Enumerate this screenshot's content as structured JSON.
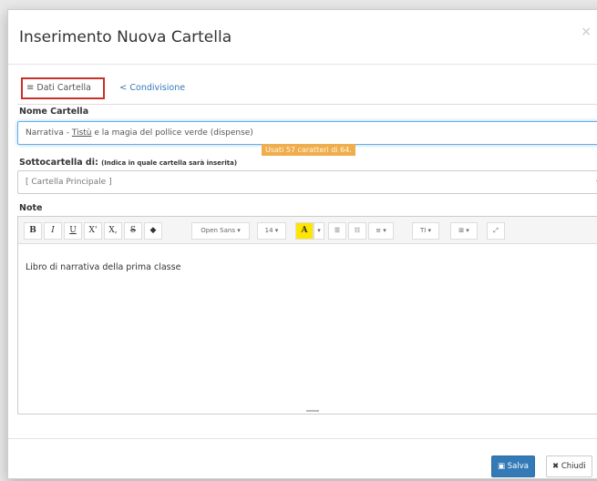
{
  "modal": {
    "title": "Inserimento Nuova Cartella",
    "close_label": "×"
  },
  "tabs": [
    {
      "icon": "≡",
      "label": "Dati Cartella",
      "active": true
    },
    {
      "icon": "<",
      "label": "Condivisione",
      "active": false
    }
  ],
  "nome": {
    "label": "Nome Cartella",
    "value_prefix": "Narrativa - ",
    "value_underlined": "Tistù",
    "value_suffix": " e la magia del pollice verde (dispense)",
    "counter": "Usati 57 caratteri di 64."
  },
  "sottocartella": {
    "label": "Sottocartella di:",
    "hint": "(Indica in quale cartella sarà inserita)",
    "selected": "[ Cartella Principale ]",
    "arrow": "▾"
  },
  "note": {
    "label": "Note",
    "content": "Libro di narrativa della prima classe"
  },
  "toolbar": {
    "bold": "B",
    "italic": "I",
    "underline": "U",
    "superscript": "X'",
    "subscript": "X,",
    "strikethrough": "S",
    "eraser": "◆",
    "font": "Open Sans ▾",
    "size": "14 ▾",
    "color": "A",
    "color_dd": "▾",
    "ul": "☰",
    "ol": "☷",
    "align": "≡ ▾",
    "height": "TI ▾",
    "table": "⊞ ▾",
    "fullscreen": "⤢"
  },
  "footer": {
    "save_label": "Salva",
    "save_icon": "▣",
    "close_label": "Chiudi",
    "close_icon": "✖"
  },
  "colors": {
    "primary": "#337ab7",
    "tab_highlight": "#c9302c",
    "counter_bg": "#f0ad4e"
  }
}
